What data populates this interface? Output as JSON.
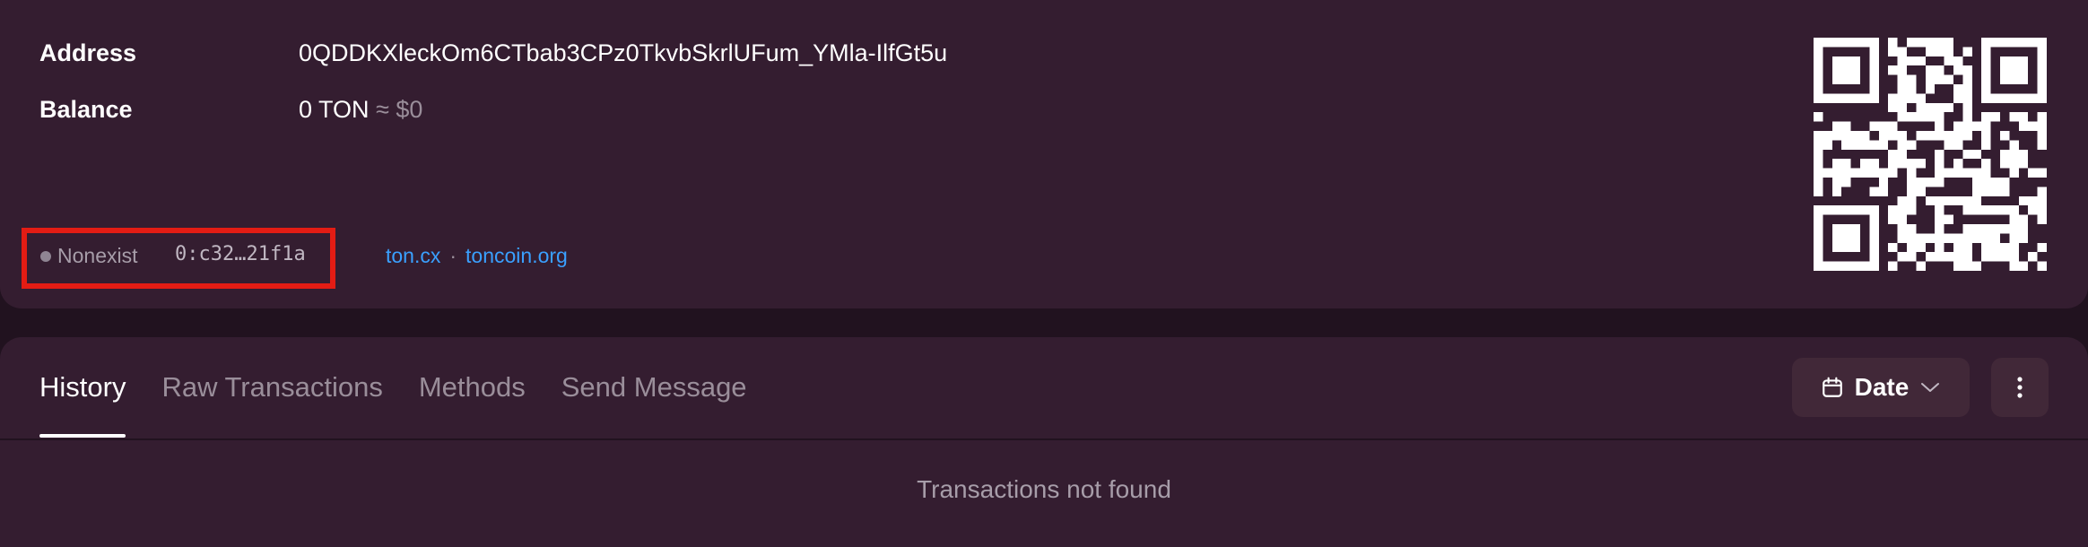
{
  "account": {
    "address_label": "Address",
    "address_value": "0QDDKXleckOm6CTbab3CPz0TkvbSkrlUFum_YMla-IlfGt5u",
    "balance_label": "Balance",
    "balance_value": "0 TON",
    "balance_fiat": "≈ $0",
    "status": "Nonexist",
    "raw_address": "0:c32…21f1a",
    "links": [
      "ton.cx",
      "toncoin.org"
    ],
    "link_separator": "·",
    "qr_icon": "qr-code"
  },
  "tabs": [
    {
      "label": "History",
      "active": true
    },
    {
      "label": "Raw Transactions",
      "active": false
    },
    {
      "label": "Methods",
      "active": false
    },
    {
      "label": "Send Message",
      "active": false
    }
  ],
  "toolbar": {
    "date_label": "Date",
    "date_icon": "calendar-icon",
    "more_icon": "more-vertical-icon"
  },
  "history": {
    "empty_message": "Transactions not found"
  },
  "colors": {
    "background": "#21121f",
    "card": "#341d30",
    "link": "#3aa0ff",
    "highlight_border": "#e31c14",
    "muted_text": "#9a8e9a"
  }
}
